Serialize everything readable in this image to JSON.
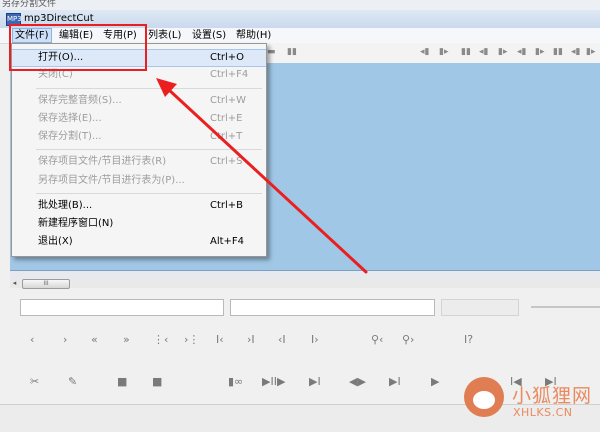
{
  "window": {
    "title": "mp3DirectCut",
    "icon_text": "MP3",
    "top_fragment": "另存分割文件"
  },
  "menubar": {
    "items": [
      {
        "label": "文件(F)",
        "active": true
      },
      {
        "label": "编辑(E)"
      },
      {
        "label": "专用(P)"
      },
      {
        "label": "列表(L)"
      },
      {
        "label": "设置(S)"
      },
      {
        "label": "帮助(H)"
      }
    ]
  },
  "file_menu": {
    "items": [
      {
        "label": "打开(O)...",
        "shortcut": "Ctrl+O",
        "state": "highlight"
      },
      {
        "label": "关闭(C)",
        "shortcut": "Ctrl+F4",
        "state": "disabled"
      },
      {
        "label": "保存完整音频(S)...",
        "shortcut": "Ctrl+W",
        "state": "disabled"
      },
      {
        "label": "保存选择(E)...",
        "shortcut": "Ctrl+E",
        "state": "disabled"
      },
      {
        "label": "保存分割(T)...",
        "shortcut": "Ctrl+T",
        "state": "disabled"
      },
      {
        "label": "保存项目文件/节目进行表(R)",
        "shortcut": "Ctrl+S",
        "state": "disabled"
      },
      {
        "label": "另存项目文件/节目进行表为(P)...",
        "shortcut": "",
        "state": "disabled"
      },
      {
        "label": "批处理(B)...",
        "shortcut": "Ctrl+B",
        "state": "enabled"
      },
      {
        "label": "新建程序窗口(N)",
        "shortcut": "",
        "state": "enabled"
      },
      {
        "label": "退出(X)",
        "shortcut": "Alt+F4",
        "state": "enabled"
      }
    ]
  },
  "toolbar_icons": [
    "▬",
    "▮▮",
    "◂▮",
    "▮▸",
    "▮▮",
    "◂▮",
    "▮▸",
    "◂▮",
    "▮▸",
    "▮▮",
    "◂▮",
    "▮▸",
    "▮▮"
  ],
  "scrollbar": {
    "left_arrow": "◂",
    "grip": "III"
  },
  "controls_row1": [
    "‹",
    "›",
    "«",
    "»",
    "⋮‹",
    "›⋮",
    "I‹",
    "›I",
    "‹I",
    "I›",
    "⚲‹",
    "⚲›",
    "I?"
  ],
  "controls_row2": [
    "✂",
    "✎",
    "■",
    "■",
    "▮∞",
    "▶II▶",
    "▶I",
    "◀▶",
    "▶I",
    "▶",
    "I◀",
    "▶I"
  ],
  "watermark": {
    "cn": "小狐狸网",
    "url": "XHLKS.CN"
  },
  "colors": {
    "waveform_bg": "#a1c7e6",
    "annotation_red": "#ea1f1f",
    "watermark": "#e98a5f"
  }
}
